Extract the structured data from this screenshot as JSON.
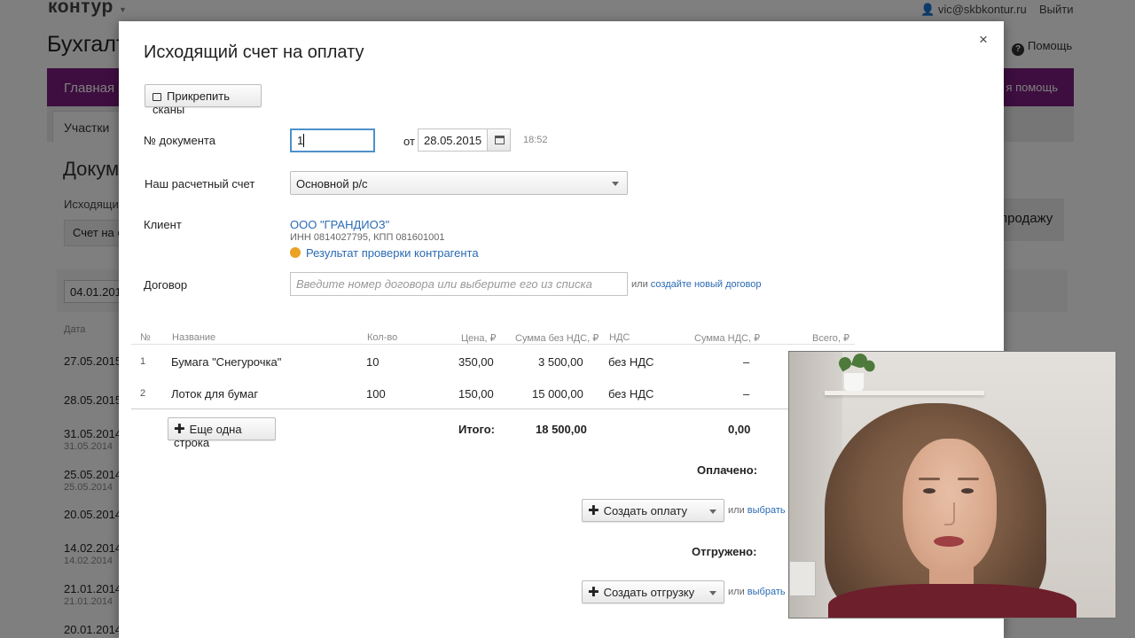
{
  "app": {
    "logo": "контур",
    "user": "vic@skbkontur.ru",
    "logout": "Выйти",
    "title": "Бухгалт",
    "help": "Помощь",
    "nav_main": "Главная",
    "nav_help": "я помощь",
    "tab_participants": "Участки",
    "doc_heading": "Докум",
    "outgoing_label": "Исходящи",
    "invoice_button": "Счет на о",
    "sale_button": "продажу",
    "date_filter": "04.01.201",
    "list_header_date": "Дата",
    "list_rows": [
      {
        "date": "27.05.2015",
        "sub": ""
      },
      {
        "date": "28.05.2015",
        "sub": ""
      },
      {
        "date": "31.05.2014",
        "sub": "31.05.2014"
      },
      {
        "date": "25.05.2014",
        "sub": "25.05.2014"
      },
      {
        "date": "20.05.2014",
        "sub": ""
      },
      {
        "date": "14.02.2014",
        "sub": "14.02.2014"
      },
      {
        "date": "21.01.2014",
        "sub": "21.01.2014"
      },
      {
        "date": "20.01.2014",
        "sub": ""
      }
    ]
  },
  "modal": {
    "title": "Исходящий счет на оплату",
    "close": "×",
    "attach_button": "Прикрепить сканы",
    "doc_number_label": "№ документа",
    "doc_number_value": "1",
    "date_from_label": "от",
    "date_value": "28.05.2015",
    "time": "18:52",
    "account_label": "Наш расчетный счет",
    "account_value": "Основной р/с",
    "client_label": "Клиент",
    "client_name": "ООО \"ГРАНДИОЗ\"",
    "client_inn": "ИНН 0814027795, КПП 081601001",
    "client_check": "Результат проверки контрагента",
    "contract_label": "Договор",
    "contract_placeholder": "Введите номер договора или выберите его из списка",
    "contract_or": "или",
    "contract_create_link": "создайте новый договор",
    "table": {
      "headers": {
        "num": "№",
        "name": "Название",
        "qty": "Кол-во",
        "price": "Цена, ₽",
        "sum_no_vat": "Сумма без НДС, ₽",
        "vat": "НДС",
        "vat_sum": "Сумма НДС, ₽",
        "total": "Всего, ₽"
      },
      "rows": [
        {
          "num": "1",
          "name": "Бумага \"Снегурочка\"",
          "qty": "10",
          "price": "350,00",
          "sum_no_vat": "3 500,00",
          "vat": "без НДС",
          "vat_sum": "–"
        },
        {
          "num": "2",
          "name": "Лоток для бумаг",
          "qty": "100",
          "price": "150,00",
          "sum_no_vat": "15 000,00",
          "vat": "без НДС",
          "vat_sum": "–"
        }
      ],
      "add_row_button": "Еще одна строка",
      "total_label": "Итого:",
      "total_no_vat": "18 500,00",
      "total_vat": "0,00"
    },
    "paid_label": "Оплачено:",
    "create_payment_button": "Создать оплату",
    "payment_or": "или",
    "payment_link": "выбрать су",
    "shipped_label": "Отгружено:",
    "create_shipment_button": "Создать отгрузку",
    "shipment_or": "или",
    "shipment_link": "выбрать су"
  },
  "colors": {
    "nav_purple": "#7a1d7e",
    "link_blue": "#2a6bb3",
    "check_dot": "#e9a224",
    "focus_border": "#4d90c9"
  }
}
